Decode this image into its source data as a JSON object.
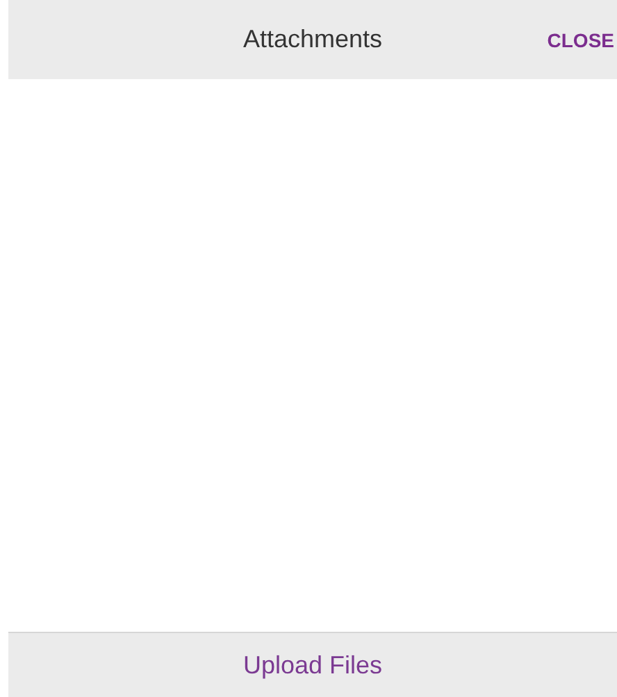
{
  "header": {
    "title": "Attachments",
    "close_label": "CLOSE"
  },
  "footer": {
    "upload_label": "Upload Files"
  }
}
